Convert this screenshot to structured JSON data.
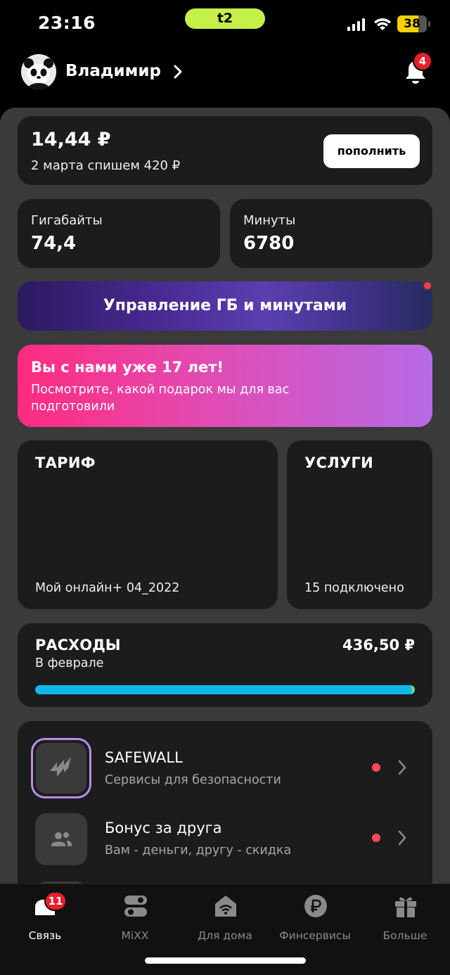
{
  "status_bar": {
    "time": "23:16",
    "carrier": "t2",
    "battery": "38"
  },
  "header": {
    "username": "Владимир",
    "notifications_count": "4"
  },
  "balance": {
    "amount": "14,44 ₽",
    "charge_note": "2 марта спишем 420 ₽",
    "topup_label": "пополнить"
  },
  "gigabytes": {
    "label": "Гигабайты",
    "value": "74,4"
  },
  "minutes": {
    "label": "Минуты",
    "value": "6780"
  },
  "manage_button": {
    "label": "Управление ГБ и минутами"
  },
  "promo": {
    "title": "Вы с нами уже 17 лет!",
    "description": "Посмотрите, какой подарок мы для вас подготовили"
  },
  "tariff": {
    "title": "ТАРИФ",
    "name": "Мой онлайн+ 04_2022"
  },
  "services": {
    "title": "УСЛУГИ",
    "connected": "15 подключено"
  },
  "expenses": {
    "title": "РАСХОДЫ",
    "period": "В феврале",
    "amount": "436,50 ₽",
    "progress_fraction": 0.99
  },
  "list": [
    {
      "name": "SAFEWALL",
      "description": "Сервисы для безопасности",
      "icon": "safewall-icon"
    },
    {
      "name": "Бонус за друга",
      "description": "Вам - деньги, другу - скидка",
      "icon": "friends-icon"
    }
  ],
  "nav": {
    "badge": "11",
    "tabs": [
      {
        "label": "Связь",
        "icon": "connection-icon"
      },
      {
        "label": "MiXX",
        "icon": "mixx-icon"
      },
      {
        "label": "Для дома",
        "icon": "home-wifi-icon"
      },
      {
        "label": "Финсервисы",
        "icon": "ruble-icon"
      },
      {
        "label": "Больше",
        "icon": "gift-icon"
      }
    ]
  },
  "colors": {
    "accent_green": "#c5f04a",
    "progress": "#10b7ec",
    "badge_red": "#e8202a",
    "promo_start": "#ff2b7f",
    "promo_end": "#b66ae6"
  }
}
